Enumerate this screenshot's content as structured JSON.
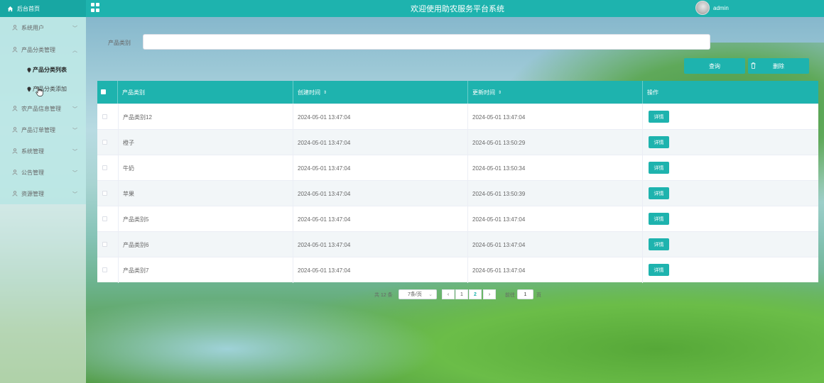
{
  "header": {
    "home_label": "后台首页",
    "title": "欢迎使用助农服务平台系统",
    "username": "admin"
  },
  "sidebar": {
    "items": [
      {
        "label": "系统用户",
        "expanded": false
      },
      {
        "label": "产品分类管理",
        "expanded": true
      },
      {
        "label": "农产品信息管理",
        "expanded": false
      },
      {
        "label": "产品订单管理",
        "expanded": false
      },
      {
        "label": "系统管理",
        "expanded": false
      },
      {
        "label": "公告管理",
        "expanded": false
      },
      {
        "label": "资源管理",
        "expanded": false
      }
    ],
    "subitems": [
      {
        "label": "产品分类列表",
        "active": true
      },
      {
        "label": "产品分类添加",
        "active": false
      }
    ]
  },
  "search": {
    "label": "产品类别",
    "value": "",
    "query_button": "查询",
    "delete_button": "删除"
  },
  "table": {
    "columns": [
      "产品类别",
      "创建时间",
      "更新时间",
      "操作"
    ],
    "sort_indicator": "⇕",
    "action_label": "详情",
    "rows": [
      {
        "category": "产品类别12",
        "created": "2024-05-01 13:47:04",
        "updated": "2024-05-01 13:47:04"
      },
      {
        "category": "橙子",
        "created": "2024-05-01 13:47:04",
        "updated": "2024-05-01 13:50:29"
      },
      {
        "category": "牛奶",
        "created": "2024-05-01 13:47:04",
        "updated": "2024-05-01 13:50:34"
      },
      {
        "category": "苹果",
        "created": "2024-05-01 13:47:04",
        "updated": "2024-05-01 13:50:39"
      },
      {
        "category": "产品类别5",
        "created": "2024-05-01 13:47:04",
        "updated": "2024-05-01 13:47:04"
      },
      {
        "category": "产品类别6",
        "created": "2024-05-01 13:47:04",
        "updated": "2024-05-01 13:47:04"
      },
      {
        "category": "产品类别7",
        "created": "2024-05-01 13:47:04",
        "updated": "2024-05-01 13:47:04"
      }
    ]
  },
  "pagination": {
    "total": "共 12 条",
    "page_size": "7条/页",
    "prev": "‹",
    "next": "›",
    "pages": [
      "1",
      "2"
    ],
    "current_page": "2",
    "goto_label": "前往",
    "goto_value": "1",
    "unit": "页"
  },
  "colors": {
    "accent": "#1eb3ae",
    "sidebar_bg": "#bee8e6"
  },
  "icons": {
    "home": "home-icon",
    "grid": "grid-menu-icon",
    "user": "user-icon",
    "chevron": "chevron-icon",
    "pin": "location-pin-icon",
    "trash": "trash-icon"
  }
}
